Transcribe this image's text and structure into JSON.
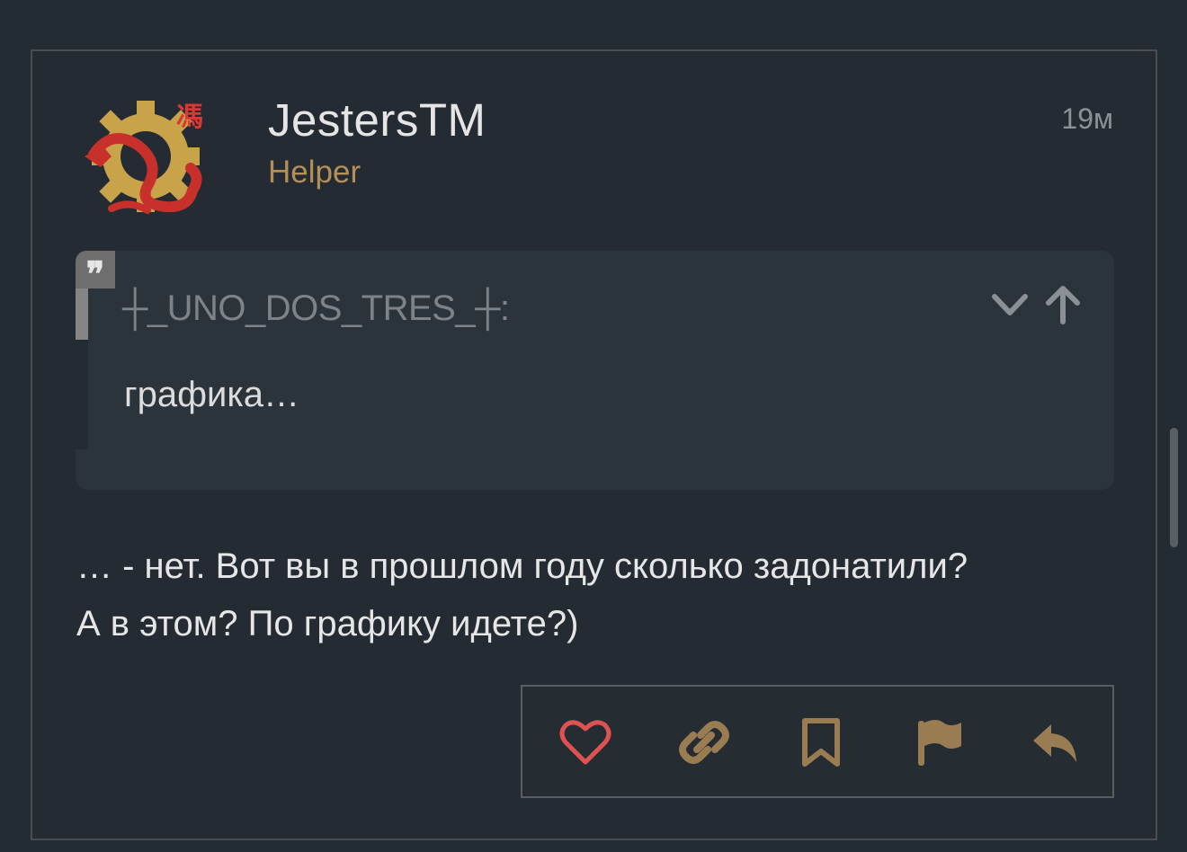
{
  "post": {
    "author": "JestersTM",
    "role": "Helper",
    "time": "19м",
    "quote": {
      "mark": "❞",
      "author": "┼_UNO_DOS_TRES_┼:",
      "text": "графика…"
    },
    "message_line1": "… - нет. Вот вы в прошлом году сколько задонатили?",
    "message_line2": "А в этом? По графику идете?)"
  },
  "colors": {
    "background": "#242c33",
    "role": "#b58f58",
    "like": "#e05252",
    "action": "#9a7c52"
  },
  "icons": {
    "avatar": "dragon-gear-avatar",
    "expand": "chevron-down-icon",
    "jump": "arrow-up-icon",
    "like": "heart-icon",
    "link": "link-icon",
    "bookmark": "bookmark-icon",
    "flag": "flag-icon",
    "reply": "reply-icon"
  }
}
